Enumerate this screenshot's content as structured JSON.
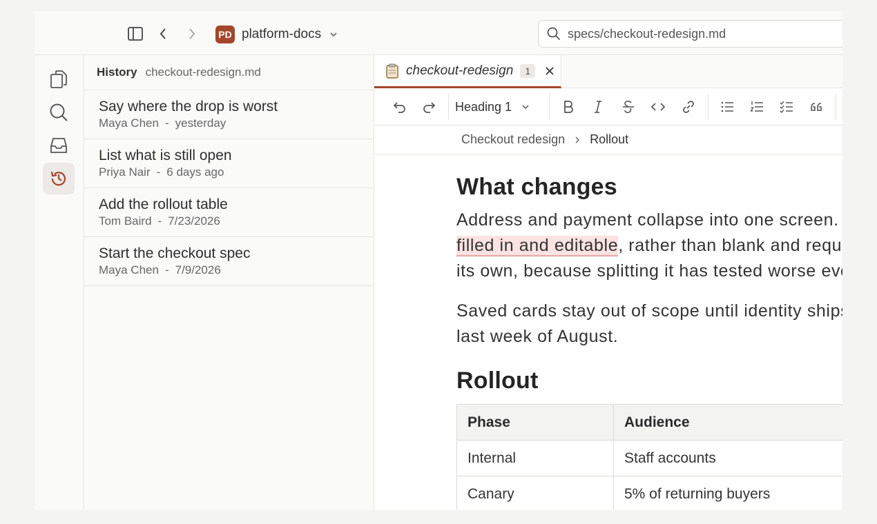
{
  "workspace": {
    "badge": "PD",
    "name": "platform-docs"
  },
  "search": {
    "value": "specs/checkout-redesign.md"
  },
  "rail": {
    "icons": [
      "files-icon",
      "search-icon",
      "inbox-icon",
      "history-icon"
    ]
  },
  "history": {
    "title": "History",
    "file": "checkout-redesign.md",
    "items": [
      {
        "message": "Say where the drop is worst",
        "author": "Maya Chen",
        "sep": "-",
        "time": "yesterday"
      },
      {
        "message": "List what is still open",
        "author": "Priya Nair",
        "sep": "-",
        "time": "6 days ago"
      },
      {
        "message": "Add the rollout table",
        "author": "Tom Baird",
        "sep": "-",
        "time": "7/23/2026"
      },
      {
        "message": "Start the checkout spec",
        "author": "Maya Chen",
        "sep": "-",
        "time": "7/9/2026"
      }
    ]
  },
  "tab": {
    "name": "checkout-redesign",
    "badge": "1"
  },
  "toolbar": {
    "heading": "Heading 1"
  },
  "breadcrumb": {
    "parent": "Checkout redesign",
    "current": "Rollout"
  },
  "doc": {
    "h_changes": "What changes",
    "p1_line1": "Address and payment collapse into one screen. Anyt",
    "p1_highlight": "filled in and editable",
    "p1_line2_rest": ", rather than blank and required. ",
    "p1_line3": "its own, because splitting it has tested worse every ti",
    "p2_line1": "Saved cards stay out of scope until identity ships sin",
    "p2_line2": "last week of August.",
    "h_rollout": "Rollout",
    "table": {
      "headers": [
        "Phase",
        "Audience"
      ],
      "rows": [
        [
          "Internal",
          "Staff accounts"
        ],
        [
          "Canary",
          "5% of returning buyers"
        ]
      ]
    }
  },
  "colors": {
    "accent": "#a4462a",
    "highlight": "#fbe3e2"
  }
}
